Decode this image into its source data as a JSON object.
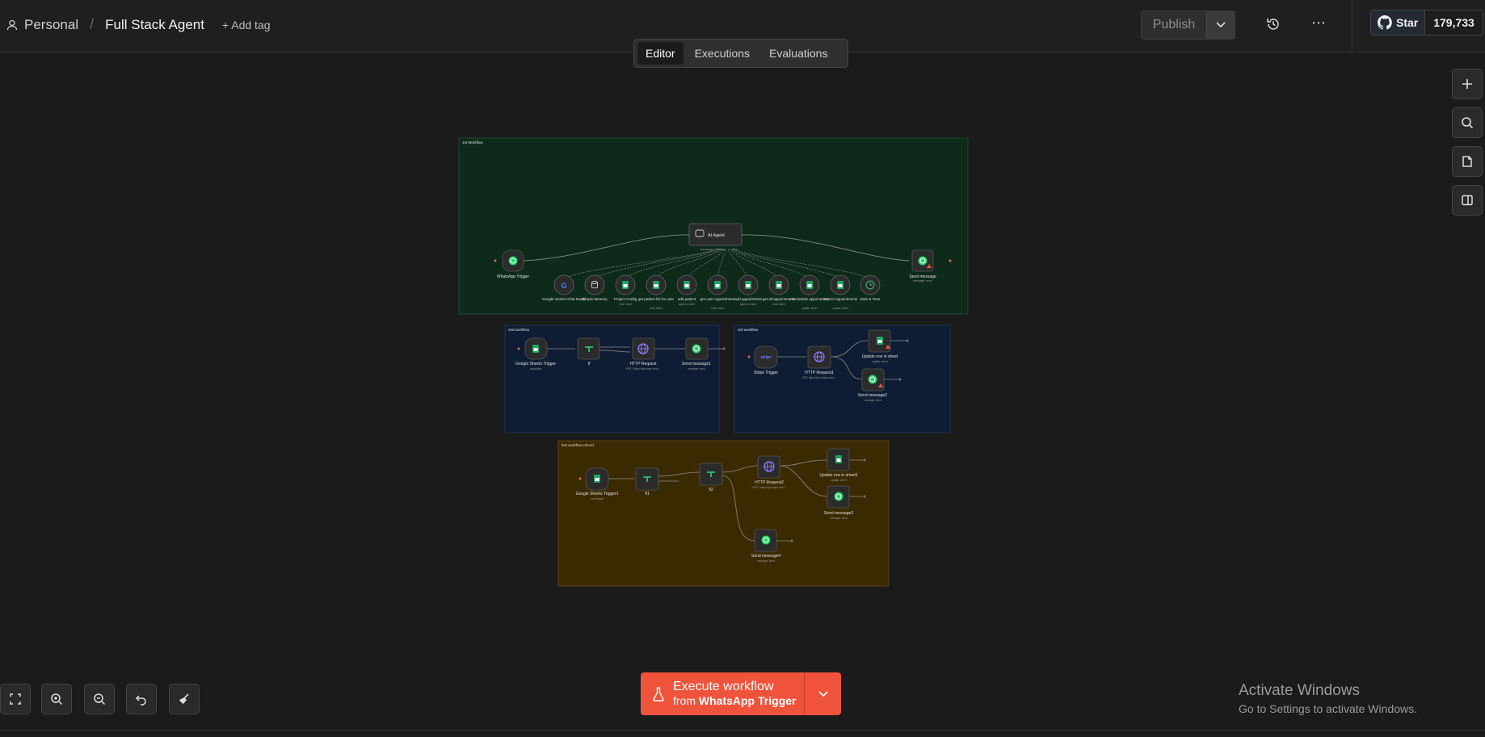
{
  "breadcrumb": {
    "project": "Personal",
    "workflow_name": "Full Stack Agent",
    "add_tag": "+ Add tag"
  },
  "header": {
    "publish_label": "Publish",
    "github_star_label": "Star",
    "github_star_count": "179,733"
  },
  "tabs": [
    {
      "label": "Editor",
      "active": true
    },
    {
      "label": "Executions",
      "active": false
    },
    {
      "label": "Evaluations",
      "active": false
    }
  ],
  "canvas": {
    "groups": [
      {
        "label": "1st Workflow",
        "color": "#0d2a1b"
      },
      {
        "label": "2nd workflow",
        "color": "#0e1d33"
      },
      {
        "label": "3rd workflow",
        "color": "#0e1d33"
      },
      {
        "label": "last workflow refund",
        "color": "#3a2a02"
      }
    ],
    "nodes": {
      "whatsapp_trigger": "WhatsApp Trigger",
      "ai_agent": "AI Agent",
      "ai_agent_ports": [
        "Chat Model*",
        "Memory",
        "Tool"
      ],
      "send_message": "Send message",
      "send_message_sub": "message: send",
      "tools": [
        {
          "label": "Google Gemini Chat Model",
          "sub": ""
        },
        {
          "label": "Simple Memory",
          "sub": ""
        },
        {
          "label": "Project Config",
          "sub": "read: sheet"
        },
        {
          "label": "get patient list for user",
          "sub": "read: sheet"
        },
        {
          "label": "add patient",
          "sub": "append: sheet"
        },
        {
          "label": "get user Appointment",
          "sub": "read: sheet"
        },
        {
          "label": "add appointment",
          "sub": "append: sheet"
        },
        {
          "label": "get all appointments",
          "sub": "read: sheet"
        },
        {
          "label": "reschedule appointment",
          "sub": "update: sheet"
        },
        {
          "label": "Cancel Appointments",
          "sub": "update: sheet"
        },
        {
          "label": "Date & Time",
          "sub": ""
        }
      ],
      "wf2": [
        {
          "label": "Google Sheets Trigger",
          "sub": "rowAdded"
        },
        {
          "label": "If",
          "sub": ""
        },
        {
          "label": "HTTP Request",
          "sub": "POST: https://api.stripe.com/..."
        },
        {
          "label": "Send message1",
          "sub": "message: send"
        }
      ],
      "wf3": [
        {
          "label": "Stripe Trigger",
          "sub": ""
        },
        {
          "label": "HTTP Request1",
          "sub": "GET: https://api.stripe.com/v..."
        },
        {
          "label": "Update row in sheet",
          "sub": "update: sheet"
        },
        {
          "label": "Send message2",
          "sub": "message: send"
        }
      ],
      "wf4": [
        {
          "label": "Google Sheets Trigger1",
          "sub": "rowUpdate"
        },
        {
          "label": "If1",
          "sub": ""
        },
        {
          "label": "If2",
          "sub": ""
        },
        {
          "label": "HTTP Request2",
          "sub": "POST: https://api.stripe.com/..."
        },
        {
          "label": "Update row in sheet1",
          "sub": "update: sheet"
        },
        {
          "label": "Send message3",
          "sub": "message: send"
        },
        {
          "label": "Send message4",
          "sub": "message: send"
        }
      ],
      "stripe_badge": "stripe"
    }
  },
  "execute": {
    "line1": "Execute workflow",
    "line2_prefix": "from ",
    "line2_trigger": "WhatsApp Trigger"
  },
  "watermark": {
    "title": "Activate Windows",
    "subtitle": "Go to Settings to activate Windows."
  }
}
